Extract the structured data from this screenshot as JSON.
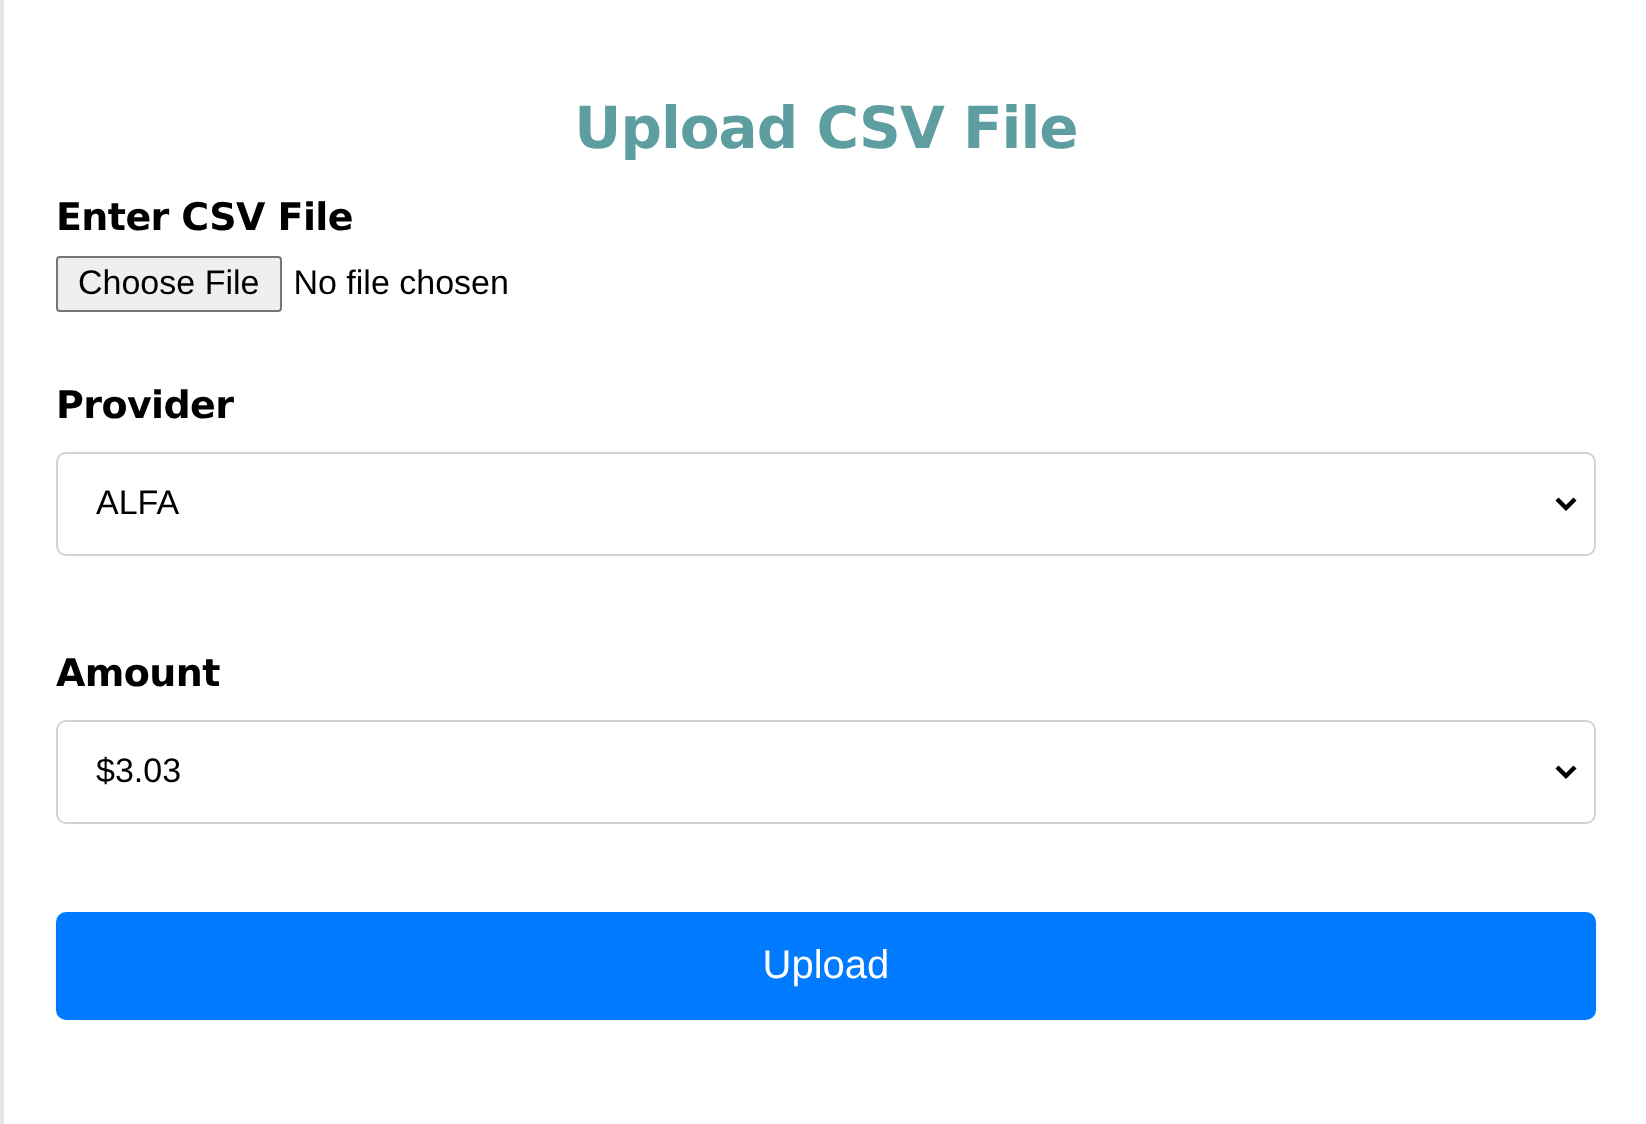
{
  "title": "Upload CSV File",
  "file_field": {
    "label": "Enter CSV File",
    "button": "Choose File",
    "status": "No file chosen"
  },
  "selects": [
    {
      "label": "Provider",
      "value": "ALFA"
    },
    {
      "label": "Amount",
      "value": "$3.03"
    }
  ],
  "submit": {
    "label": "Upload"
  }
}
